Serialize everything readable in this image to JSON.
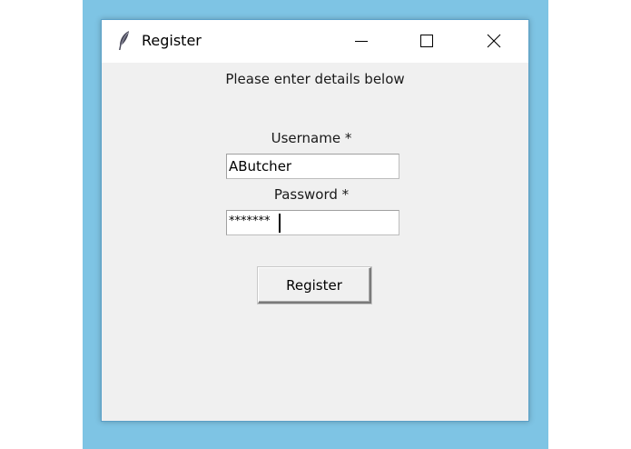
{
  "window": {
    "title": "Register",
    "app_icon": "feather-icon",
    "controls": {
      "minimize": "minimize-icon",
      "maximize": "maximize-icon",
      "close": "close-icon"
    }
  },
  "form": {
    "instruction": "Please enter details below",
    "username_label": "Username *",
    "username_value": "AButcher",
    "password_label": "Password *",
    "password_value": "*******",
    "register_label": "Register"
  },
  "colors": {
    "desktop": "#7ec4e4",
    "window_body": "#f0f0f0",
    "titlebar": "#ffffff"
  }
}
